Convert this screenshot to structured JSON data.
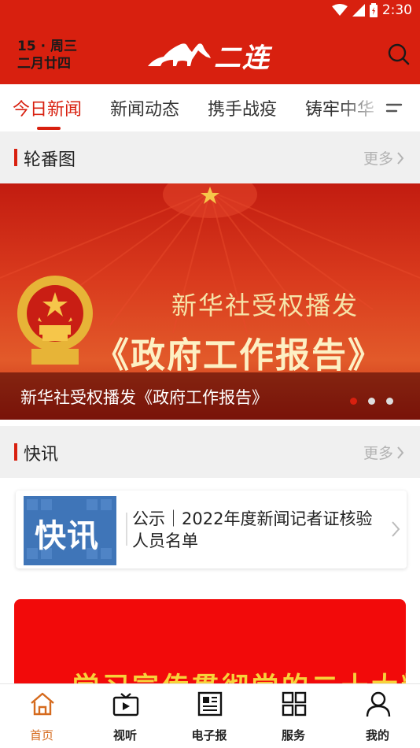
{
  "status_bar": {
    "time": "2:30"
  },
  "header": {
    "date_line1": "15 · 周三",
    "date_line2": "二月廿四",
    "logo_text": "二连"
  },
  "tabs": [
    {
      "label": "今日新闻",
      "active": true
    },
    {
      "label": "新闻动态",
      "active": false
    },
    {
      "label": "携手战疫",
      "active": false
    },
    {
      "label": "铸牢中华",
      "active": false
    }
  ],
  "carousel_section": {
    "title": "轮番图",
    "more": "更多"
  },
  "banner": {
    "line1": "新华社受权播发",
    "line2": "《政府工作报告》",
    "caption": "新华社受权播发《政府工作报告》",
    "dot_count": 3,
    "active_dot": 0
  },
  "flash_section": {
    "title": "快讯",
    "more": "更多"
  },
  "news_item": {
    "thumb_label": "快讯",
    "title": "公示｜2022年度新闻记者证核验人员名单"
  },
  "promo": {
    "text": "学习宣传贯彻党的二十大精神"
  },
  "bottom_nav": [
    {
      "label": "首页",
      "icon": "home-icon",
      "active": true
    },
    {
      "label": "视听",
      "icon": "tv-icon",
      "active": false
    },
    {
      "label": "电子报",
      "icon": "newspaper-icon",
      "active": false
    },
    {
      "label": "服务",
      "icon": "grid-icon",
      "active": false
    },
    {
      "label": "我的",
      "icon": "user-icon",
      "active": false
    }
  ],
  "colors": {
    "brand_red": "#d8200f",
    "active_nav": "#d56a1d",
    "promo_red": "#f20a0a",
    "promo_text": "#f7d23a"
  }
}
